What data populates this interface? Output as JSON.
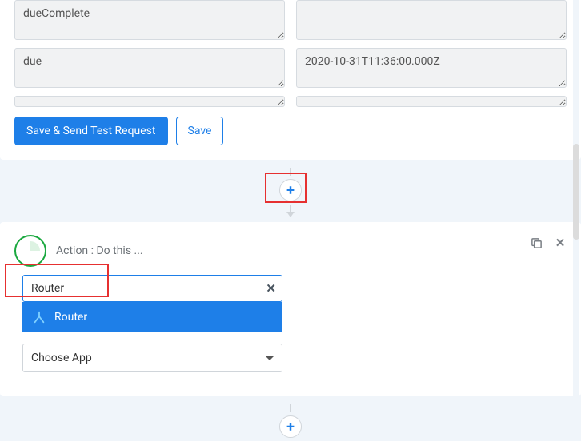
{
  "fields": {
    "row1": {
      "key": "dueComplete",
      "value": ""
    },
    "row2": {
      "key": "due",
      "value": "2020-10-31T11:36:00.000Z"
    }
  },
  "buttons": {
    "save_send": "Save & Send Test Request",
    "save": "Save"
  },
  "action": {
    "title": "Action : Do this ...",
    "search_value": "Router",
    "dropdown_option": "Router",
    "choose_app": "Choose App"
  },
  "icons": {
    "plus": "+",
    "clear": "✕",
    "close": "✕"
  }
}
